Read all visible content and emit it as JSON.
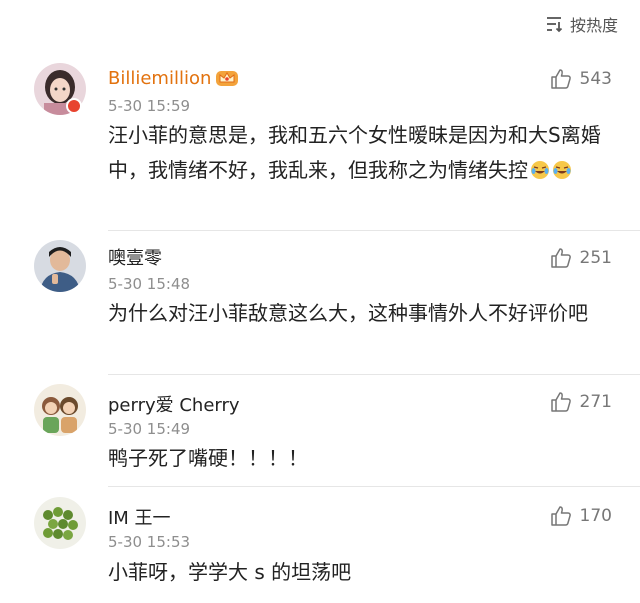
{
  "sort": {
    "label": "按热度",
    "icon": "sort-icon"
  },
  "comments": [
    {
      "username": "Billiemillion",
      "time": "5-30 15:59",
      "likes": "543",
      "text": "汪小菲的意思是，我和五六个女性暧昧是因为和大S离婚中，我情绪不好，我乱来，但我称之为情绪失控",
      "avatar": "avatar-girl",
      "vip": true,
      "emojis": [
        "laugh-cry-emoji",
        "laugh-cry-emoji"
      ]
    },
    {
      "username": "噢壹零",
      "time": "5-30 15:48",
      "likes": "251",
      "text": "为什么对汪小菲敌意这么大，这种事情外人不好评价吧",
      "avatar": "avatar-man"
    },
    {
      "username": "perry爱 Cherry",
      "time": "5-30 15:49",
      "likes": "271",
      "text": "鸭子死了嘴硬！！！！",
      "avatar": "avatar-cartoon"
    },
    {
      "username": "IM 王一",
      "time": "5-30 15:53",
      "likes": "170",
      "text": "小菲呀，学学大 s 的坦荡吧",
      "avatar": "avatar-peas"
    }
  ],
  "colors": {
    "vip_name": "#e2720e",
    "badge": "#e8432f",
    "text": "#222222",
    "meta": "#8e8e8e"
  }
}
